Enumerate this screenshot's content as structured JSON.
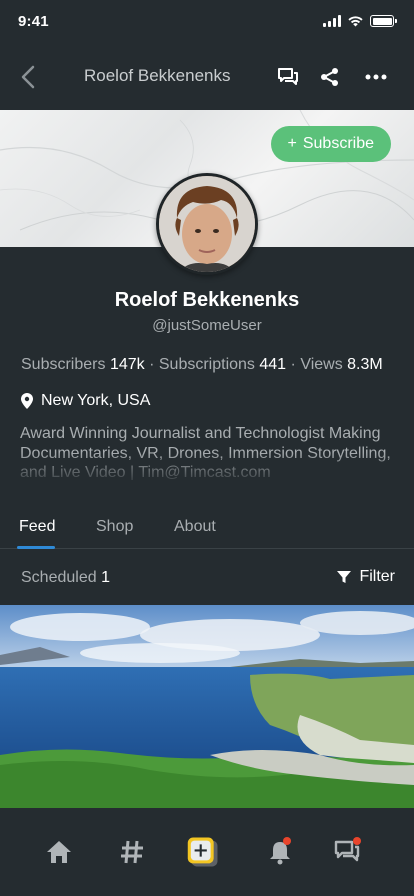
{
  "status_bar": {
    "time": "9:41",
    "icons": [
      "signal-icon",
      "wifi-icon",
      "battery-icon"
    ]
  },
  "nav": {
    "title": "Roelof Bekkenenks",
    "back_icon": "chevron-left-icon",
    "actions": [
      "chat-icon",
      "share-icon",
      "more-icon"
    ]
  },
  "cover": {
    "subscribe_label": "Subscribe",
    "subscribe_icon": "+"
  },
  "profile": {
    "name": "Roelof Bekkenenks",
    "handle": "@justSomeUser",
    "stats": {
      "subscribers_label": "Subscribers",
      "subscribers_value": "147k",
      "subscriptions_label": "Subscriptions",
      "subscriptions_value": "441",
      "views_label": "Views",
      "views_value": "8.3M",
      "separator": "·"
    },
    "location": "New York, USA",
    "bio": "Award Winning Journalist and Technologist Making Documentaries, VR, Drones, Immersion Storytelling, and Live Video | Tim@Timcast.com"
  },
  "tabs": [
    {
      "label": "Feed",
      "active": true
    },
    {
      "label": "Shop",
      "active": false
    },
    {
      "label": "About",
      "active": false
    }
  ],
  "feed": {
    "scheduled_label": "Scheduled",
    "scheduled_count": "1",
    "filter_label": "Filter"
  },
  "bottom_nav": [
    "home-icon",
    "hashtag-icon",
    "add-post-icon",
    "notifications-icon",
    "messages-icon"
  ],
  "colors": {
    "background": "#252c30",
    "accent_green": "#5bc17a",
    "tab_indicator": "#2f8ad6",
    "badge_red": "#e8452c",
    "add_button_yellow": "#f3c623"
  }
}
